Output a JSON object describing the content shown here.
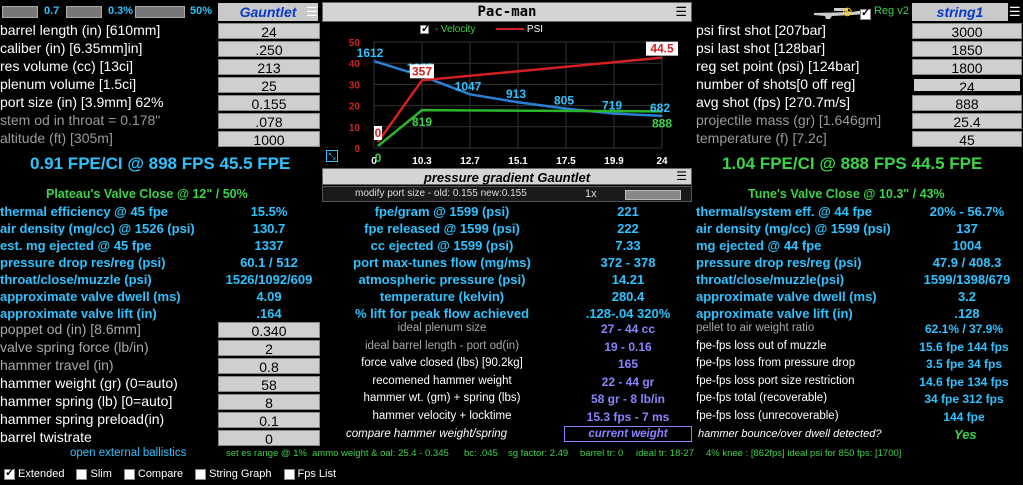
{
  "topbar": {
    "left_val1": "0.7",
    "left_val2": "0.3%",
    "left_val3": "50%",
    "left_title": "Gauntlet",
    "center_title": "Pac-man",
    "right_reg": "Reg v2",
    "right_title": "string1"
  },
  "left_inputs": [
    {
      "label": "barrel length (in) [610mm]",
      "value": "24"
    },
    {
      "label": "caliber (in) [6.35mm]in]",
      "value": ".250"
    },
    {
      "label": "res volume (cc) [13ci]",
      "value": "213"
    },
    {
      "label": "plenum volume [1.5ci]",
      "value": "25"
    },
    {
      "label": "port size (in) [3.9mm] 62%",
      "value": "0.155"
    },
    {
      "label": "stem od in throat = 0.178\"",
      "value": ".078"
    },
    {
      "label": "altitude (ft) [305m]",
      "value": "1000"
    }
  ],
  "right_inputs": [
    {
      "label": "psi first shot [207bar]",
      "value": "3000"
    },
    {
      "label": "psi last shot  [128bar]",
      "value": "1850"
    },
    {
      "label": "reg set point (psi) [124bar]",
      "value": "1800"
    },
    {
      "label": "number of shots[0 off reg]",
      "value": "24"
    },
    {
      "label": "avg shot (fps) [270.7m/s]",
      "value": "888"
    },
    {
      "label": "projectile mass (gr) [1.646gm]",
      "value": "25.4"
    },
    {
      "label": "temperature (f) [7.2c]",
      "value": "45"
    }
  ],
  "fpe_left": "0.91 FPE/CI @ 898 FPS 45.5 FPE",
  "fpe_right": "1.04 FPE/CI @ 888 FPS 44.5 FPE",
  "plateau_left": "Plateau's  Valve Close @ 12\" / 50%",
  "plateau_right": "Tune's Valve Close @ 10.3\" / 43%",
  "pressure_gradient": "pressure gradient Gauntlet",
  "modify_port": "modify port size - old: 0.155 new:0.155",
  "zoom": "1x",
  "left_stats": [
    {
      "label": "thermal efficiency @ 45 fpe",
      "value": "15.5%"
    },
    {
      "label": "air density (mg/cc) @ 1526 (psi)",
      "value": "130.7"
    },
    {
      "label": "est. mg ejected @ 45 fpe",
      "value": "1337"
    },
    {
      "label": "pressure drop res/reg (psi)",
      "value": "60.1 / 512"
    },
    {
      "label": "throat/close/muzzle (psi)",
      "value": "1526/1092/609"
    },
    {
      "label": "approximate valve dwell (ms)",
      "value": "4.09"
    },
    {
      "label": "approximate valve lift (in)",
      "value": ".164"
    }
  ],
  "center_stats": [
    {
      "label": "fpe/gram @ 1599 (psi)",
      "value": "221"
    },
    {
      "label": "fpe released @ 1599 (psi)",
      "value": "222"
    },
    {
      "label": "cc ejected @ 1599 (psi)",
      "value": "7.33"
    },
    {
      "label": "port max-tunes flow (mg/ms)",
      "value": "372 - 378"
    },
    {
      "label": "atmospheric pressure (psi)",
      "value": "14.21"
    },
    {
      "label": "temperature (kelvin)",
      "value": "280.4"
    },
    {
      "label": "% lift for peak flow achieved",
      "value": ".128-.04 320%"
    }
  ],
  "right_stats": [
    {
      "label": "thermal/system eff. @ 44 fpe",
      "value": "20% - 56.7%"
    },
    {
      "label": "air density (mg/cc) @ 1599 (psi)",
      "value": "137"
    },
    {
      "label": "mg ejected @ 44 fpe",
      "value": "1004"
    },
    {
      "label": "pressure drop res/reg (psi)",
      "value": "47.9 / 408.3"
    },
    {
      "label": "throat/close/muzzle(psi)",
      "value": "1599/1398/679"
    },
    {
      "label": "approximate valve dwell (ms)",
      "value": "3.2"
    },
    {
      "label": "approximate valve lift (in)",
      "value": ".128"
    }
  ],
  "left_lower": [
    {
      "label": "poppet od (in) [8.6mm]",
      "value": "0.340"
    },
    {
      "label": "valve spring force (lb/in)",
      "value": "2"
    },
    {
      "label": "hammer travel (in)",
      "value": "0.8"
    },
    {
      "label": "hammer weight (gr) (0=auto)",
      "value": "58"
    },
    {
      "label": "hammer spring (lb) [0=auto]",
      "value": "8"
    },
    {
      "label": "hammer spring preload(in)",
      "value": "0.1"
    },
    {
      "label": "barrel twistrate",
      "value": "0"
    }
  ],
  "center_lower": [
    {
      "label": "ideal plenum size",
      "value": "27 - 44 cc"
    },
    {
      "label": "ideal barrel length - port od(in)",
      "value": "19 - 0.16"
    },
    {
      "label": "force valve closed (lbs) [90.2kg]",
      "value": "165"
    },
    {
      "label": "recomened hammer weight",
      "value": "22 - 44 gr"
    },
    {
      "label": "hammer wt. (gm) +  spring (lbs)",
      "value": "58 gr - 8 lb/in"
    },
    {
      "label": "hammer velocity + locktime",
      "value": "15.3 fps - 7 ms"
    }
  ],
  "compare_label": "compare hammer weight/spring",
  "compare_button": "current weight",
  "right_lower": [
    {
      "label": "pellet to air weight ratio",
      "value": "62.1% / 37.9%"
    },
    {
      "label": "fpe-fps loss out of muzzle",
      "value": "15.6 fpe  144 fps"
    },
    {
      "label": "fpe-fps loss from pressure drop",
      "value": "3.5 fpe  34 fps"
    },
    {
      "label": "fpe-fps loss port size restriction",
      "value": "14.6 fpe  134 fps"
    },
    {
      "label": "fpe-fps total (recoverable)",
      "value": "34 fpe  312 fps"
    },
    {
      "label": "fpe-fps loss (unrecoverable)",
      "value": "144 fpe"
    }
  ],
  "bounce_label": "hammer bounce/over dwell detected?",
  "bounce_value": "Yes",
  "footer": {
    "ext_ballistics": "open external ballistics",
    "set_es": "set es range @ 1%",
    "ammo": "ammo weight & oal: 25.4 - 0.345",
    "bc": "bc: .045",
    "sg": "sg factor: 2.49",
    "barrel_tr": "barrel tr: 0",
    "ideal_tr": "ideal tr: 18-27",
    "knee": "4% knee : [862fps] ideal psi for 850 fps: [1700]"
  },
  "checkboxes": [
    {
      "label": "Extended",
      "checked": true
    },
    {
      "label": "Slim",
      "checked": false
    },
    {
      "label": "Compare",
      "checked": false
    },
    {
      "label": "String Graph",
      "checked": false
    },
    {
      "label": "Fps List",
      "checked": false
    }
  ],
  "chart_data": {
    "type": "line",
    "x": [
      0,
      10.3,
      12.7,
      15.1,
      17.5,
      19.9,
      24
    ],
    "x_tick_labels": [
      "0",
      "10.3",
      "12.7",
      "15.1",
      "17.5",
      "19.9",
      "24"
    ],
    "y_tick_labels": [
      "0",
      "10",
      "20",
      "30",
      "40",
      "50"
    ],
    "legend": [
      "- Velocity",
      "PSI"
    ],
    "series": [
      {
        "name": "- Velocity",
        "color": "#2a7fd4",
        "values": [
          1612,
          1357,
          1047,
          913,
          805,
          719,
          682
        ],
        "labels": [
          "1612",
          "1357",
          "1047",
          "913",
          "805",
          "719",
          "682"
        ]
      },
      {
        "name": "PSI",
        "color": "#d42020",
        "values": [
          0,
          357,
          null,
          null,
          null,
          null,
          44.5
        ],
        "labels": [
          "0",
          "357",
          "",
          "",
          "",
          "",
          "44.5"
        ]
      },
      {
        "name": "energy",
        "color": "#2bb52b",
        "values": [
          0,
          819,
          null,
          null,
          null,
          null,
          888
        ],
        "labels": [
          "0",
          "819",
          "",
          "",
          "",
          "",
          "888"
        ]
      }
    ]
  }
}
